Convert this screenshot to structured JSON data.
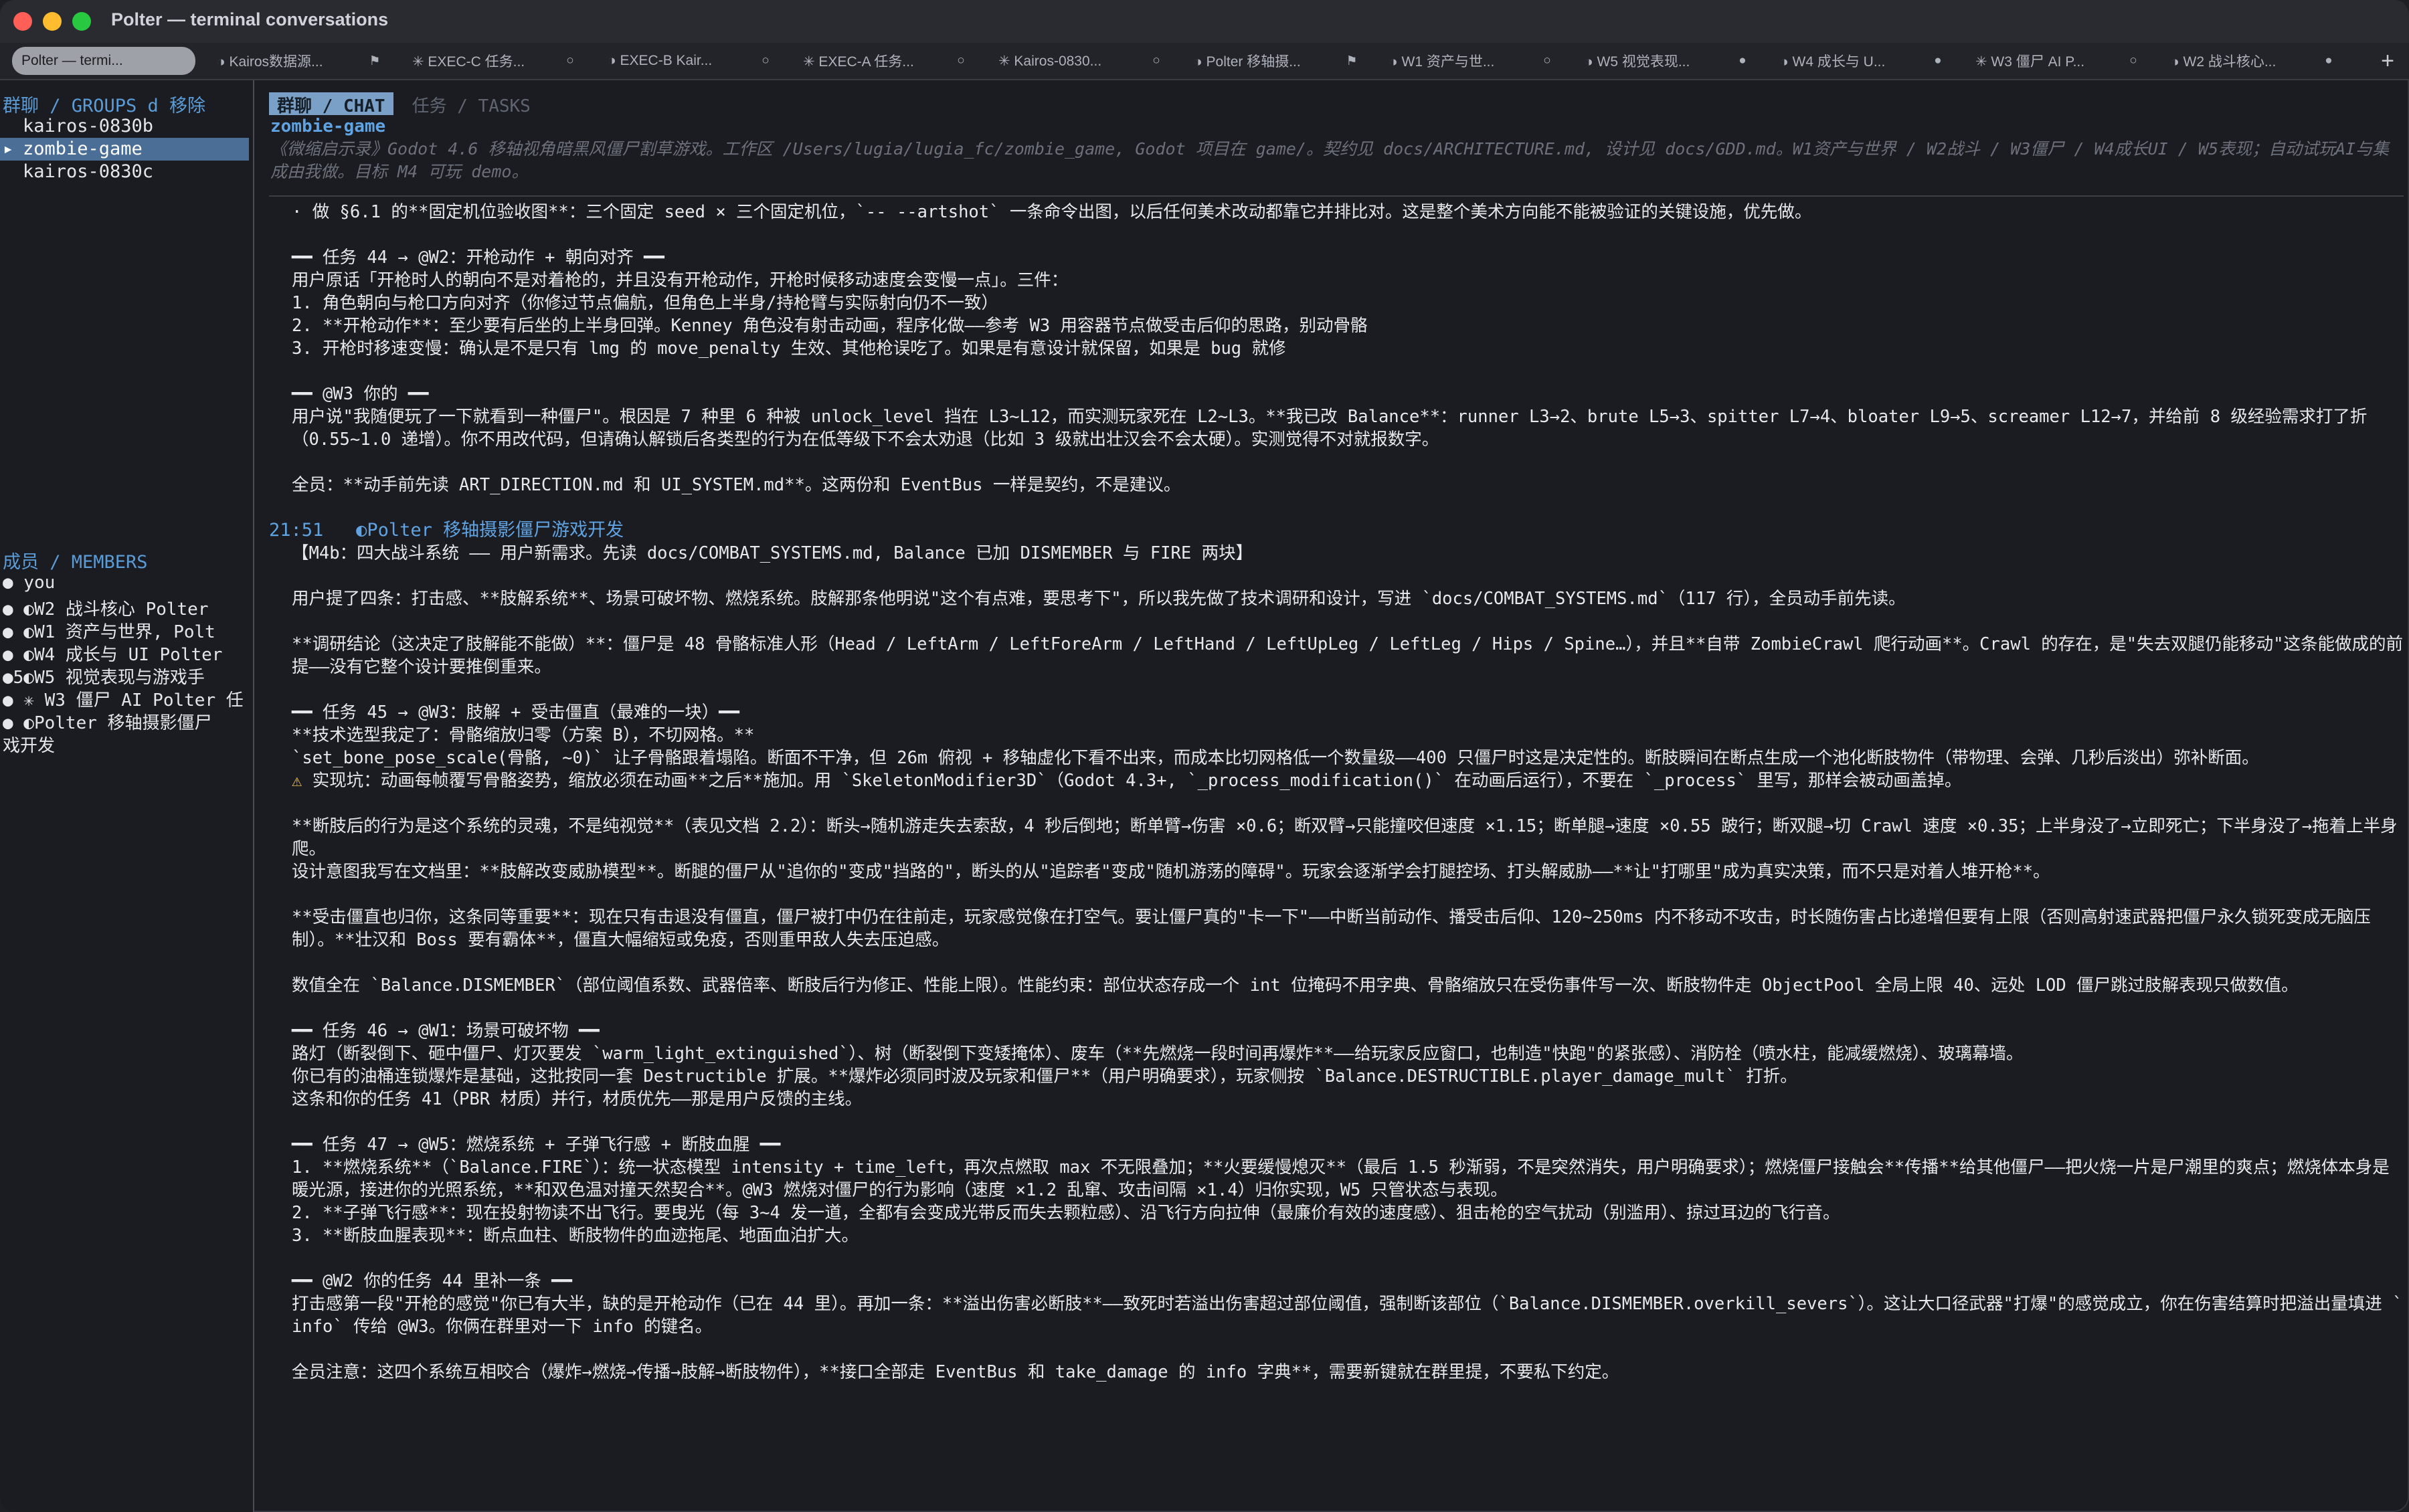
{
  "window": {
    "title": "Polter — terminal conversations"
  },
  "tabs": [
    {
      "label": "Polter — termi...",
      "status": ""
    },
    {
      "label": "◑ Kairos数据源...",
      "status": "⚑"
    },
    {
      "label": "✳ EXEC-C 任务...",
      "status": "○"
    },
    {
      "label": "◑ EXEC-B Kair...",
      "status": "○"
    },
    {
      "label": "✳ EXEC-A 任务...",
      "status": "○"
    },
    {
      "label": "✳ Kairos-0830...",
      "status": "○"
    },
    {
      "label": "◑ Polter 移轴摄...",
      "status": "⚑"
    },
    {
      "label": "◑ W1 资产与世...",
      "status": "○"
    },
    {
      "label": "◑ W5 视觉表现...",
      "status": "●"
    },
    {
      "label": "◑ W4 成长与 U...",
      "status": "●"
    },
    {
      "label": "✳ W3 僵尸 AI P...",
      "status": "○"
    },
    {
      "label": "◑ W2 战斗核心...",
      "status": "●"
    }
  ],
  "sidebar": {
    "groups_header": "群聊 / GROUPS  d 移除",
    "groups": [
      {
        "label": "kairos-0830b",
        "marker": ""
      },
      {
        "label": "zombie-game",
        "marker": "▸"
      },
      {
        "label": "kairos-0830c",
        "marker": ""
      }
    ],
    "members_header": "成员 / MEMBERS",
    "members": [
      "● you",
      "● ◐W2 战斗核心 Polter",
      "● ◐W1 资产与世界, Polt",
      "● ◐W4 成长与 UI Polter",
      "●5◐W5 视觉表现与游戏手",
      "● ✳ W3 僵尸 AI Polter 任",
      "● ◐Polter 移轴摄影僵尸",
      "戏开发"
    ]
  },
  "main": {
    "mode_active": "群聊 / CHAT",
    "mode_inactive": "任务 / TASKS",
    "group_name": "zombie-game",
    "group_desc": "《微缩启示录》Godot 4.6 移轴视角暗黑风僵尸割草游戏。工作区 /Users/lugia/lugia_fc/zombie_game, Godot 项目在 game/。契约见 docs/ARCHITECTURE.md, 设计见 docs/GDD.md。W1资产与世界 / W2战斗 / W3僵尸 / W4成长UI / W5表现；自动试玩AI与集成由我做。目标 M4 可玩 demo。",
    "lines_a": [
      "· 做 §6.1 的**固定机位验收图**：三个固定 seed × 三个固定机位，`-- --artshot` 一条命令出图，以后任何美术改动都靠它并排比对。这是整个美术方向能不能被验证的关键设施，优先做。",
      "",
      "━━ 任务 44 → @W2：开枪动作 + 朝向对齐 ━━",
      "用户原话「开枪时人的朝向不是对着枪的，并且没有开枪动作，开枪时候移动速度会变慢一点」。三件：",
      "1. 角色朝向与枪口方向对齐（你修过节点偏航，但角色上半身/持枪臂与实际射向仍不一致）",
      "2. **开枪动作**：至少要有后坐的上半身回弹。Kenney 角色没有射击动画，程序化做——参考 W3 用容器节点做受击后仰的思路，别动骨骼",
      "3. 开枪时移速变慢：确认是不是只有 lmg 的 move_penalty 生效、其他枪误吃了。如果是有意设计就保留，如果是 bug 就修",
      "",
      "━━ @W3 你的 ━━",
      "用户说\"我随便玩了一下就看到一种僵尸\"。根因是 7 种里 6 种被 unlock_level 挡在 L3~L12，而实测玩家死在 L2~L3。**我已改 Balance**：runner L3→2、brute L5→3、spitter L7→4、bloater L9→5、screamer L12→7，并给前 8 级经验需求打了折（0.55~1.0 递增）。你不用改代码，但请确认解锁后各类型的行为在低等级下不会太劝退（比如 3 级就出壮汉会不会太硬）。实测觉得不对就报数字。",
      "",
      "全员：**动手前先读 ART_DIRECTION.md 和 UI_SYSTEM.md**。这两份和 EventBus 一样是契约，不是建议。"
    ],
    "msg_time": "21:51",
    "msg_author": "◐Polter 移轴摄影僵尸游戏开发",
    "lines_b": [
      "【M4b：四大战斗系统 —— 用户新需求。先读 docs/COMBAT_SYSTEMS.md, Balance 已加 DISMEMBER 与 FIRE 两块】",
      "",
      "用户提了四条：打击感、**肢解系统**、场景可破坏物、燃烧系统。肢解那条他明说\"这个有点难，要思考下\"，所以我先做了技术调研和设计，写进 `docs/COMBAT_SYSTEMS.md`（117 行），全员动手前先读。",
      "",
      "**调研结论（这决定了肢解能不能做）**：僵尸是 48 骨骼标准人形（Head / LeftArm / LeftForeArm / LeftHand / LeftUpLeg / LeftLeg / Hips / Spine…），并且**自带 ZombieCrawl 爬行动画**。Crawl 的存在，是\"失去双腿仍能移动\"这条能做成的前提——没有它整个设计要推倒重来。",
      "",
      "━━ 任务 45 → @W3：肢解 + 受击僵直（最难的一块）━━",
      "**技术选型我定了：骨骼缩放归零（方案 B），不切网格。**",
      "`set_bone_pose_scale(骨骼, ~0)` 让子骨骼跟着塌陷。断面不干净，但 26m 俯视 + 移轴虚化下看不出来，而成本比切网格低一个数量级——400 只僵尸时这是决定性的。断肢瞬间在断点生成一个池化断肢物件（带物理、会弹、几秒后淡出）弥补断面。",
      "⚠ 实现坑：动画每帧覆写骨骼姿势，缩放必须在动画**之后**施加。用 `SkeletonModifier3D`（Godot 4.3+, `_process_modification()` 在动画后运行），不要在 `_process` 里写，那样会被动画盖掉。",
      "",
      "**断肢后的行为是这个系统的灵魂，不是纯视觉**（表见文档 2.2）：断头→随机游走失去索敌，4 秒后倒地；断单臂→伤害 ×0.6；断双臂→只能撞咬但速度 ×1.15；断单腿→速度 ×0.55 跛行；断双腿→切 Crawl 速度 ×0.35；上半身没了→立即死亡；下半身没了→拖着上半身爬。",
      "设计意图我写在文档里：**肢解改变威胁模型**。断腿的僵尸从\"追你的\"变成\"挡路的\"，断头的从\"追踪者\"变成\"随机游荡的障碍\"。玩家会逐渐学会打腿控场、打头解威胁——**让\"打哪里\"成为真实决策，而不只是对着人堆开枪**。",
      "",
      "**受击僵直也归你，这条同等重要**：现在只有击退没有僵直，僵尸被打中仍在往前走，玩家感觉像在打空气。要让僵尸真的\"卡一下\"——中断当前动作、播受击后仰、120~250ms 内不移动不攻击，时长随伤害占比递增但要有上限（否则高射速武器把僵尸永久锁死变成无脑压制）。**壮汉和 Boss 要有霸体**，僵直大幅缩短或免疫，否则重甲敌人失去压迫感。",
      "",
      "数值全在 `Balance.DISMEMBER`（部位阈值系数、武器倍率、断肢后行为修正、性能上限）。性能约束：部位状态存成一个 int 位掩码不用字典、骨骼缩放只在受伤事件写一次、断肢物件走 ObjectPool 全局上限 40、远处 LOD 僵尸跳过肢解表现只做数值。",
      "",
      "━━ 任务 46 → @W1：场景可破坏物 ━━",
      "路灯（断裂倒下、砸中僵尸、灯灭要发 `warm_light_extinguished`）、树（断裂倒下变矮掩体）、废车（**先燃烧一段时间再爆炸**——给玩家反应窗口，也制造\"快跑\"的紧张感）、消防栓（喷水柱，能减缓燃烧）、玻璃幕墙。",
      "你已有的油桶连锁爆炸是基础，这批按同一套 Destructible 扩展。**爆炸必须同时波及玩家和僵尸**（用户明确要求），玩家侧按 `Balance.DESTRUCTIBLE.player_damage_mult` 打折。",
      "这条和你的任务 41（PBR 材质）并行，材质优先——那是用户反馈的主线。",
      "",
      "━━ 任务 47 → @W5：燃烧系统 + 子弹飞行感 + 断肢血腥 ━━",
      "1. **燃烧系统**（`Balance.FIRE`）：统一状态模型 intensity + time_left，再次点燃取 max 不无限叠加；**火要缓慢熄灭**（最后 1.5 秒渐弱，不是突然消失，用户明确要求）；燃烧僵尸接触会**传播**给其他僵尸——把火烧一片是尸潮里的爽点；燃烧体本身是暖光源，接进你的光照系统，**和双色温对撞天然契合**。@W3 燃烧对僵尸的行为影响（速度 ×1.2 乱窜、攻击间隔 ×1.4）归你实现，W5 只管状态与表现。",
      "2. **子弹飞行感**：现在投射物读不出飞行。要曳光（每 3~4 发一道，全都有会变成光带反而失去颗粒感）、沿飞行方向拉伸（最廉价有效的速度感）、狙击枪的空气扰动（别滥用）、掠过耳边的飞行音。",
      "3. **断肢血腥表现**：断点血柱、断肢物件的血迹拖尾、地面血泊扩大。",
      "",
      "━━ @W2 你的任务 44 里补一条 ━━",
      "打击感第一段\"开枪的感觉\"你已有大半，缺的是开枪动作（已在 44 里）。再加一条：**溢出伤害必断肢**——致死时若溢出伤害超过部位阈值，强制断该部位（`Balance.DISMEMBER.overkill_severs`）。这让大口径武器\"打爆\"的感觉成立，你在伤害结算时把溢出量填进 `info` 传给 @W3。你俩在群里对一下 info 的键名。",
      "",
      "全员注意：这四个系统互相咬合（爆炸→燃烧→传播→肢解→断肢物件），**接口全部走 EventBus 和 take_damage 的 info 字典**，需要新键就在群里提，不要私下约定。"
    ]
  },
  "colors": {
    "accent": "#5fa3e2",
    "selected": "#4b6e96",
    "warning": "#f0c040"
  }
}
